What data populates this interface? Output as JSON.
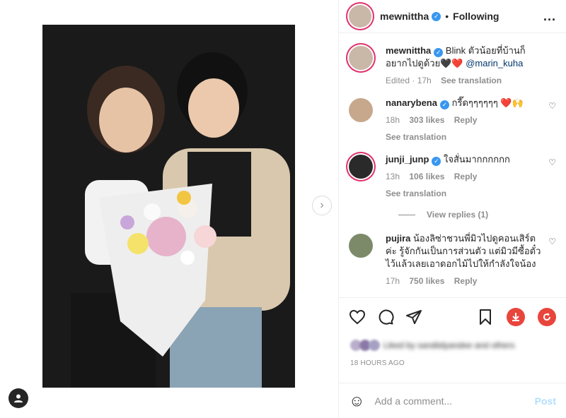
{
  "header": {
    "username": "mewnittha",
    "dot": "•",
    "following_label": "Following",
    "more_label": "..."
  },
  "caption": {
    "username": "mewnittha",
    "text": "Blink ตัวน้อยที่บ้านก็อยากไปดูด้วย🖤❤️",
    "mention": "@marin_kuha",
    "edited": "Edited · 17h",
    "see_translation": "See translation"
  },
  "comments": [
    {
      "username": "nanarybena",
      "text": "กรี๊ดๆๆๆๆๆๆ ❤️🙌",
      "time": "18h",
      "likes": "303 likes",
      "reply": "Reply",
      "see_translation": "See translation"
    },
    {
      "username": "junji_junp",
      "text": "ใจสั่นมากกกกกก",
      "time": "13h",
      "likes": "106 likes",
      "reply": "Reply",
      "see_translation": "See translation"
    },
    {
      "username": "pujira",
      "text": "น้องลิซ่าชวนพี่มิวไปดูคอนเสิร์ตค่ะ รู้จักกันเป็นการส่วนตัว แต่มิวมีซื้อตั๋วไว้แล้วเลยเอาดอกไม้ไปให้กำลังใจน้อง",
      "time": "17h",
      "likes": "750 likes",
      "reply": "Reply"
    }
  ],
  "view_replies": "View replies (1)",
  "likes_text": "Liked by sandiidyandee and others",
  "time_ago": "18 HOURS AGO",
  "add_comment": {
    "placeholder": "Add a comment...",
    "post_label": "Post"
  },
  "next_icon_glyph": "›"
}
